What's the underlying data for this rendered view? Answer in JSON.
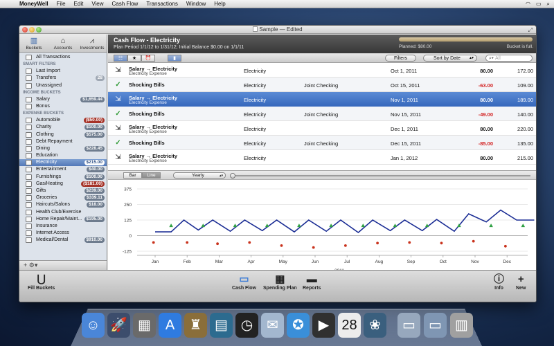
{
  "menubar": {
    "app": "MoneyWell",
    "items": [
      "File",
      "Edit",
      "View",
      "Cash Flow",
      "Transactions",
      "Window",
      "Help"
    ]
  },
  "window": {
    "title": "Sample — Edited"
  },
  "sidebar": {
    "modes": [
      "Buckets",
      "Accounts",
      "Investments"
    ],
    "all_transactions": "All Transactions",
    "smart_filters_header": "SMART FILTERS",
    "smart_filters": [
      {
        "label": "Last Import",
        "badge": ""
      },
      {
        "label": "Transfers",
        "badge": "28"
      },
      {
        "label": "Unassigned",
        "badge": ""
      }
    ],
    "income_header": "INCOME BUCKETS",
    "income": [
      {
        "label": "Salary",
        "badge": "$1,659.44",
        "neg": false
      },
      {
        "label": "Bonus",
        "badge": "",
        "neg": false
      }
    ],
    "expense_header": "EXPENSE BUCKETS",
    "expense": [
      {
        "label": "Automobile",
        "badge": "($50.00)",
        "neg": true
      },
      {
        "label": "Charity",
        "badge": "$100.00",
        "neg": false
      },
      {
        "label": "Clothing",
        "badge": "$575.00",
        "neg": false
      },
      {
        "label": "Debt Repayment",
        "badge": "",
        "neg": false
      },
      {
        "label": "Dining",
        "badge": "$228.45",
        "neg": false
      },
      {
        "label": "Education",
        "badge": "",
        "neg": false
      },
      {
        "label": "Electricity",
        "badge": "$215.00",
        "neg": false,
        "selected": true
      },
      {
        "label": "Entertainment",
        "badge": "$40.00",
        "neg": false
      },
      {
        "label": "Furnishings",
        "badge": "$100.00",
        "neg": false
      },
      {
        "label": "Gas/Heating",
        "badge": "($181.00)",
        "neg": true
      },
      {
        "label": "Gifts",
        "badge": "$239.00",
        "neg": false
      },
      {
        "label": "Groceries",
        "badge": "$339.11",
        "neg": false
      },
      {
        "label": "Haircuts/Salons",
        "badge": "$18.00",
        "neg": false
      },
      {
        "label": "Health Club/Exercise",
        "badge": "",
        "neg": false
      },
      {
        "label": "Home Repair/Maint...",
        "badge": "$195.00",
        "neg": false
      },
      {
        "label": "Insurance",
        "badge": "",
        "neg": false
      },
      {
        "label": "Internet Access",
        "badge": "",
        "neg": false
      },
      {
        "label": "Medical/Dental",
        "badge": "$910.00",
        "neg": false
      }
    ],
    "footer": "+  ⚙▾"
  },
  "header": {
    "title": "Cash Flow - Electricity",
    "subtitle": "Plan Period 1/1/12 to 1/31/12; Initial Balance $0.00 on 1/1/11",
    "planned": "Planned: $80.00",
    "bucket_status": "Bucket is full.",
    "progress": 1.0
  },
  "toolbar": {
    "filters": "Filters",
    "sort": "Sort by Date",
    "search_placeholder": "All"
  },
  "transactions": [
    {
      "icon": "transfer",
      "name": "Salary → Electricity",
      "sub": "Electricity Expense",
      "category": "Electricity",
      "account": "",
      "date": "Oct 1, 2011",
      "amount": "80.00",
      "neg": false,
      "balance": "172.00"
    },
    {
      "icon": "check",
      "name": "Shocking Bills",
      "sub": "",
      "category": "Electricity",
      "account": "Joint Checking",
      "date": "Oct 15, 2011",
      "amount": "-63.00",
      "neg": true,
      "balance": "109.00"
    },
    {
      "icon": "transfer",
      "name": "Salary → Electricity",
      "sub": "Electricity Expense",
      "category": "Electricity",
      "account": "",
      "date": "Nov 1, 2011",
      "amount": "80.00",
      "neg": false,
      "balance": "189.00",
      "selected": true
    },
    {
      "icon": "check",
      "name": "Shocking Bills",
      "sub": "",
      "category": "Electricity",
      "account": "Joint Checking",
      "date": "Nov 15, 2011",
      "amount": "-49.00",
      "neg": true,
      "balance": "140.00"
    },
    {
      "icon": "transfer",
      "name": "Salary → Electricity",
      "sub": "Electricity Expense",
      "category": "Electricity",
      "account": "",
      "date": "Dec 1, 2011",
      "amount": "80.00",
      "neg": false,
      "balance": "220.00"
    },
    {
      "icon": "check",
      "name": "Shocking Bills",
      "sub": "",
      "category": "Electricity",
      "account": "Joint Checking",
      "date": "Dec 15, 2011",
      "amount": "-85.00",
      "neg": true,
      "balance": "135.00"
    },
    {
      "icon": "transfer",
      "name": "Salary → Electricity",
      "sub": "Electricity Expense",
      "category": "Electricity",
      "account": "",
      "date": "Jan 1, 2012",
      "amount": "80.00",
      "neg": false,
      "balance": "215.00"
    }
  ],
  "chart_controls": {
    "bar": "Bar",
    "line": "Line",
    "period": "Yearly"
  },
  "chart_data": {
    "type": "line",
    "categories": [
      "Jan",
      "Feb",
      "Mar",
      "Apr",
      "May",
      "Jun",
      "Jul",
      "Aug",
      "Sep",
      "Oct",
      "Nov",
      "Dec"
    ],
    "yticks": [
      375,
      250,
      125,
      0,
      -125
    ],
    "ylim": [
      -125,
      375
    ],
    "xlabel": "2011",
    "balance_line": [
      [
        0.0,
        30
      ],
      [
        0.5,
        30
      ],
      [
        0.9,
        125
      ],
      [
        1.35,
        45
      ],
      [
        1.8,
        125
      ],
      [
        2.35,
        35
      ],
      [
        2.8,
        125
      ],
      [
        3.35,
        40
      ],
      [
        3.8,
        125
      ],
      [
        4.35,
        30
      ],
      [
        4.8,
        125
      ],
      [
        5.35,
        35
      ],
      [
        5.8,
        125
      ],
      [
        6.35,
        25
      ],
      [
        6.8,
        125
      ],
      [
        7.35,
        40
      ],
      [
        7.8,
        125
      ],
      [
        8.35,
        40
      ],
      [
        8.8,
        130
      ],
      [
        9.35,
        35
      ],
      [
        9.8,
        175
      ],
      [
        10.35,
        110
      ],
      [
        10.8,
        205
      ],
      [
        11.3,
        125
      ],
      [
        11.85,
        125
      ]
    ],
    "deposits": [
      [
        0.5,
        80
      ],
      [
        1.5,
        80
      ],
      [
        2.5,
        80
      ],
      [
        3.5,
        80
      ],
      [
        4.5,
        80
      ],
      [
        5.5,
        80
      ],
      [
        6.5,
        80
      ],
      [
        7.5,
        80
      ],
      [
        8.5,
        80
      ],
      [
        9.5,
        80
      ],
      [
        10.5,
        80
      ],
      [
        11.5,
        80
      ]
    ],
    "withdrawals": [
      [
        -0.05,
        -55
      ],
      [
        1.0,
        -55
      ],
      [
        1.95,
        -65
      ],
      [
        2.95,
        -55
      ],
      [
        3.95,
        -80
      ],
      [
        4.95,
        -95
      ],
      [
        5.95,
        -80
      ],
      [
        6.95,
        -60
      ],
      [
        7.95,
        -55
      ],
      [
        8.95,
        -60
      ],
      [
        9.95,
        -45
      ],
      [
        10.95,
        -85
      ]
    ],
    "colors": {
      "line": "#1a2c94",
      "deposit": "#2fa043",
      "withdrawal": "#c9321c"
    }
  },
  "bottombar": {
    "fill_buckets": "Fill Buckets",
    "cash_flow": "Cash Flow",
    "spending_plan": "Spending Plan",
    "reports": "Reports",
    "info": "Info",
    "new": "New"
  },
  "dock": [
    {
      "name": "finder",
      "glyph": "☺"
    },
    {
      "name": "launchpad",
      "glyph": "🚀"
    },
    {
      "name": "dashboard",
      "glyph": "▦"
    },
    {
      "name": "app-store",
      "glyph": "A"
    },
    {
      "name": "moneywell",
      "glyph": "♜"
    },
    {
      "name": "cards",
      "glyph": "▤"
    },
    {
      "name": "clock",
      "glyph": "◷"
    },
    {
      "name": "mail",
      "glyph": "✉"
    },
    {
      "name": "safari",
      "glyph": "✪"
    },
    {
      "name": "facetime",
      "glyph": "▶"
    },
    {
      "name": "ical",
      "glyph": "28"
    },
    {
      "name": "iphoto",
      "glyph": "❀"
    },
    {
      "name": "documents-folder",
      "glyph": "▭"
    },
    {
      "name": "downloads-folder",
      "glyph": "▭"
    },
    {
      "name": "trash",
      "glyph": "▥"
    }
  ]
}
